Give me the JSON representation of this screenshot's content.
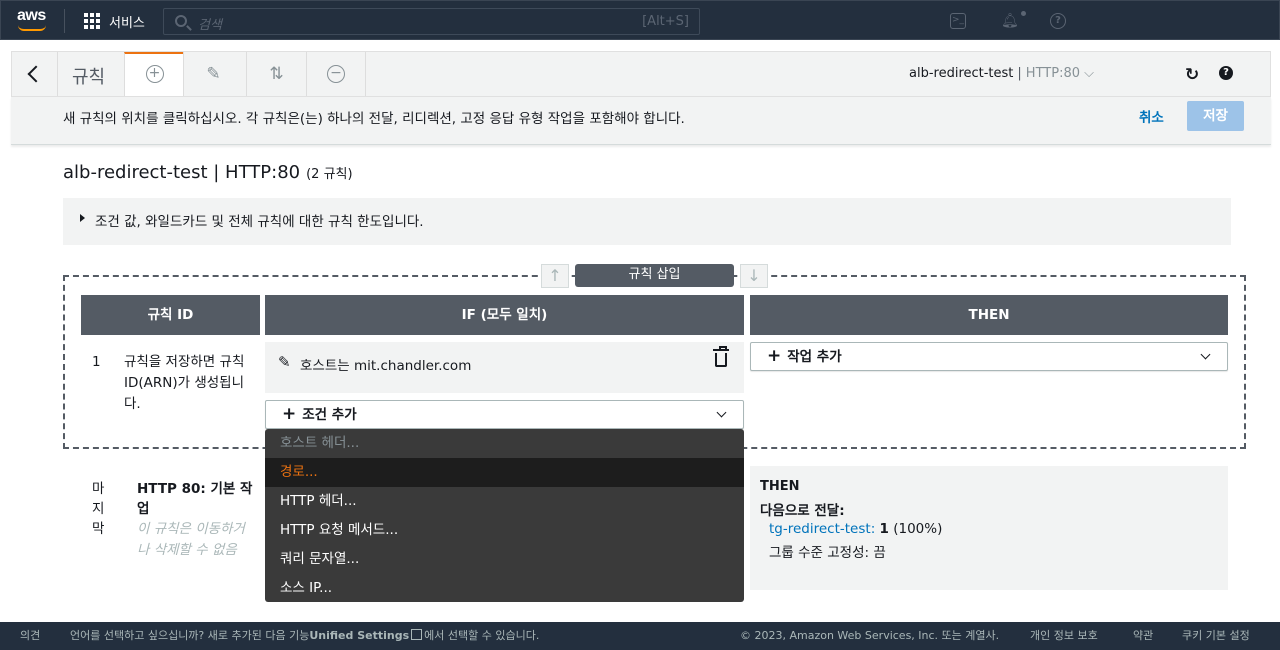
{
  "topnav": {
    "logo": "aws",
    "services": "서비스",
    "search_placeholder": "검색",
    "search_shortcut": "[Alt+S]",
    "icons": [
      "terminal-icon",
      "bell-icon",
      "help-icon"
    ]
  },
  "toolbar": {
    "title": "규칙",
    "lb_name": "alb-redirect-test",
    "separator": "|",
    "listener": "HTTP:80",
    "dropdown_glyph": "⌵",
    "tabs": [
      "add-icon",
      "edit-icon",
      "reorder-icon",
      "delete-icon"
    ]
  },
  "instruction": {
    "text": "새 규칙의 위치를 클릭하십시오. 각 규칙은(는) 하나의 전달, 리디렉션, 고정 응답 유형 작업을 포함해야 합니다.",
    "cancel": "취소",
    "save": "저장"
  },
  "page": {
    "title": "alb-redirect-test | HTTP:80",
    "count": "(2 규칙)"
  },
  "limits": {
    "text": "조건 값, 와일드카드 및 전체 규칙에 대한 규칙 한도입니다."
  },
  "insert": {
    "label": "규칙 삽입",
    "up": "↑",
    "down": "↓"
  },
  "columns": {
    "rule_id": "규칙 ID",
    "if": "IF (모두 일치)",
    "then": "THEN"
  },
  "new_rule": {
    "number": "1",
    "id_text": "규칙을 저장하면 규칙 ID(ARN)가 생성됩니다.",
    "condition_label": "호스트는",
    "condition_value": "mit.chandler.com",
    "add_condition": "조건 추가",
    "add_action": "작업 추가"
  },
  "condition_menu": [
    {
      "label": "호스트 헤더...",
      "state": "disabled"
    },
    {
      "label": "경로...",
      "state": "highlight"
    },
    {
      "label": "HTTP 헤더...",
      "state": "normal"
    },
    {
      "label": "HTTP 요청 메서드...",
      "state": "normal"
    },
    {
      "label": "쿼리 문자열...",
      "state": "normal"
    },
    {
      "label": "소스 IP...",
      "state": "normal"
    }
  ],
  "last_rule": {
    "label": "마지막",
    "title": "HTTP 80: 기본 작업",
    "note": "이 규칙은 이동하거나 삭제할 수 없음",
    "then_label": "THEN",
    "forward_label": "다음으로 전달:",
    "target_group": "tg-redirect-test",
    "weight_sep": ": ",
    "weight": "1",
    "weight_pct": " (100%)",
    "stickiness": "그룹 수준 고정성: 끔"
  },
  "footer": {
    "feedback": "의견",
    "lang_text": "언어를 선택하고 싶으십니까? 새로 추가된 다음 기능",
    "unified": "Unified Settings",
    "lang_text2": "에서 선택할 수 있습니다.",
    "copyright": "© 2023, Amazon Web Services, Inc. 또는 계열사.",
    "privacy": "개인 정보 보호",
    "terms": "약관",
    "cookies": "쿠키 기본 설정"
  },
  "colors": {
    "nav_bg": "#232f3e",
    "accent": "#ec7211",
    "link": "#0073bb",
    "header_bg": "#545b64",
    "save_disabled": "#9dc3e8"
  }
}
